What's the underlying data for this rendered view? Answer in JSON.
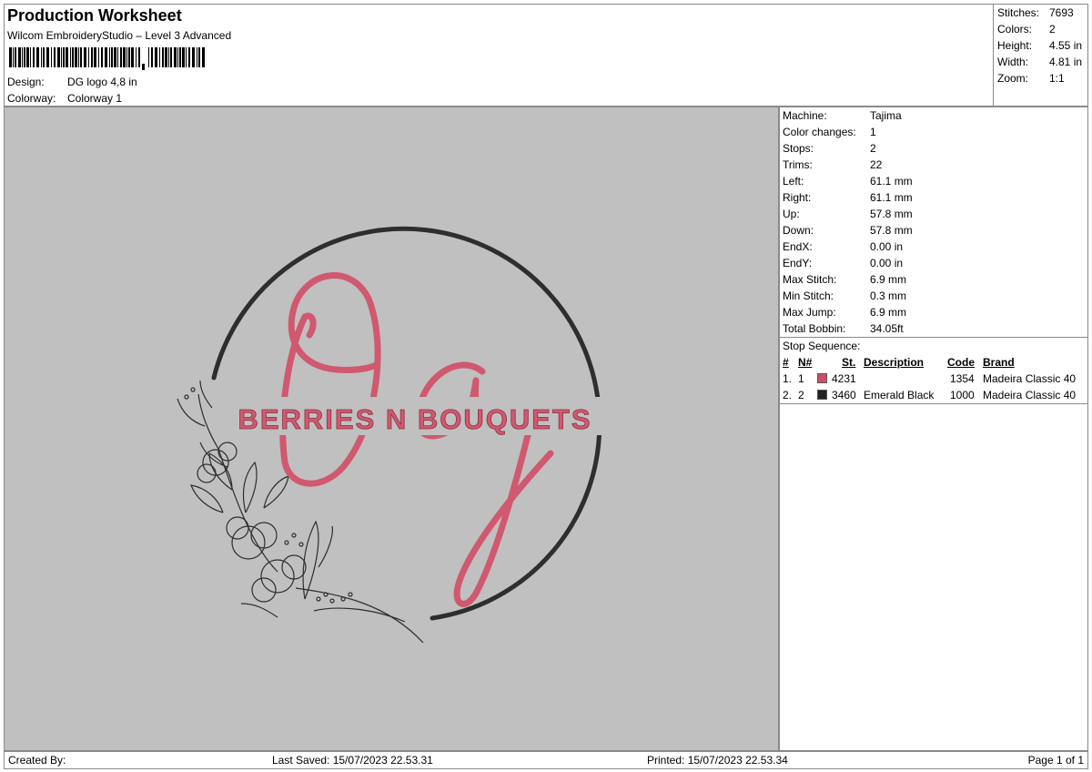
{
  "header": {
    "title": "Production Worksheet",
    "subtitle": "Wilcom EmbroideryStudio – Level 3 Advanced",
    "design_label": "Design:",
    "design_value": "DG logo 4,8 in",
    "colorway_label": "Colorway:",
    "colorway_value": "Colorway 1"
  },
  "stats": [
    {
      "label": "Stitches:",
      "value": "7693"
    },
    {
      "label": "Colors:",
      "value": "2"
    },
    {
      "label": "Height:",
      "value": "4.55 in"
    },
    {
      "label": "Width:",
      "value": "4.81 in"
    },
    {
      "label": "Zoom:",
      "value": "1:1"
    }
  ],
  "machine_info": [
    {
      "label": "Machine:",
      "value": "Tajima"
    },
    {
      "label": "Color changes:",
      "value": "1"
    },
    {
      "label": "Stops:",
      "value": "2"
    },
    {
      "label": "Trims:",
      "value": "22"
    },
    {
      "label": "Left:",
      "value": "61.1 mm"
    },
    {
      "label": "Right:",
      "value": "61.1 mm"
    },
    {
      "label": "Up:",
      "value": "57.8 mm"
    },
    {
      "label": "Down:",
      "value": "57.8 mm"
    },
    {
      "label": "EndX:",
      "value": "0.00 in"
    },
    {
      "label": "EndY:",
      "value": "0.00 in"
    },
    {
      "label": "Max Stitch:",
      "value": "6.9 mm"
    },
    {
      "label": "Min Stitch:",
      "value": "0.3 mm"
    },
    {
      "label": "Max Jump:",
      "value": "6.9 mm"
    },
    {
      "label": "Total Bobbin:",
      "value": "34.05ft"
    }
  ],
  "stop_sequence": {
    "title": "Stop Sequence:",
    "headers": {
      "num": "#",
      "n": "N#",
      "st": "St.",
      "description": "Description",
      "code": "Code",
      "brand": "Brand"
    },
    "rows": [
      {
        "num": "1.",
        "n": "1",
        "color": "#c94f6a",
        "st": "4231",
        "description": "",
        "code": "1354",
        "brand": "Madeira Classic 40"
      },
      {
        "num": "2.",
        "n": "2",
        "color": "#222222",
        "st": "3460",
        "description": "Emerald Black",
        "code": "1000",
        "brand": "Madeira Classic 40"
      }
    ]
  },
  "design_preview": {
    "text": "BERRIES N BOUQUETS",
    "background": "#c0c0c0",
    "pink": "#d0596f",
    "dark": "#2e2e2e"
  },
  "footer": {
    "created_by": "Created By:",
    "last_saved": "Last Saved: 15/07/2023 22.53.31",
    "printed": "Printed: 15/07/2023 22.53.34",
    "page": "Page 1 of 1"
  }
}
